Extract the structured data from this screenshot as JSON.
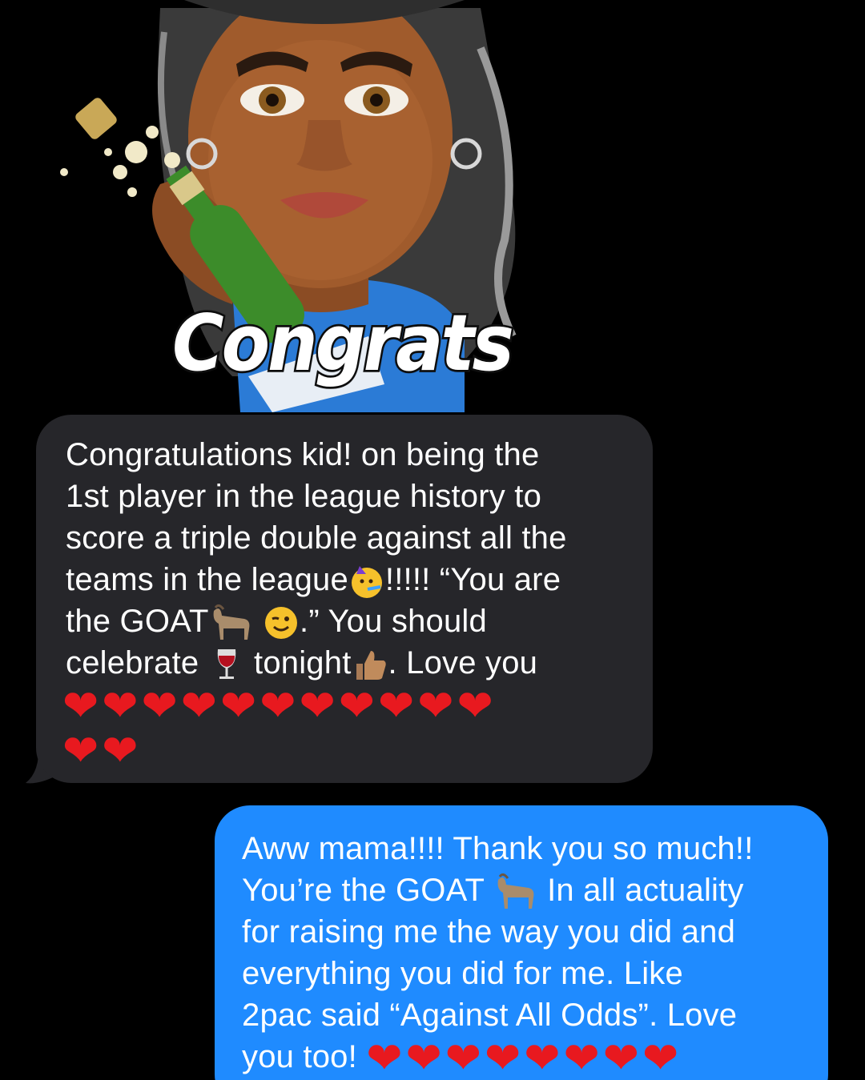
{
  "sticker": {
    "caption": "Congrats",
    "icon": "memoji-champagne-celebration"
  },
  "incoming_message": {
    "lines": [
      "Congratulations kid! on being the",
      "1st player in the league history to",
      "score a triple double against all the"
    ],
    "line4_text_a": "teams in the league",
    "line4_emoji": "partying-face-icon",
    "line4_text_b": "!!!!! “You are",
    "line5_text_a": "the GOAT",
    "line5_emoji_1": "goat-icon",
    "line5_emoji_2": "winking-face-icon",
    "line5_text_b": ".” You should",
    "line6_text_a": "celebrate",
    "line6_emoji_1": "wine-glass-icon",
    "line6_text_b": "tonight",
    "line6_emoji_2": "thumbs-up-icon",
    "line6_text_c": ". Love you",
    "hearts_row1": "❤❤❤❤❤❤❤❤❤❤❤",
    "hearts_row2": "❤❤"
  },
  "outgoing_message": {
    "line1": "Aww mama!!!! Thank you so much!!",
    "line2_text_a": "You’re the GOAT",
    "line2_emoji": "goat-icon",
    "line2_text_b": "In all actuality",
    "line3": "for raising me the way you did and",
    "line4": "everything you did for me. Like",
    "line5": "2pac said “Against All Odds”. Love",
    "line6_text": "you too!",
    "hearts_row": "❤❤❤❤❤❤❤❤"
  },
  "colors": {
    "background": "#000000",
    "incoming_bubble": "#26262a",
    "outgoing_bubble": "#1f8bff",
    "heart": "#e8191f"
  }
}
